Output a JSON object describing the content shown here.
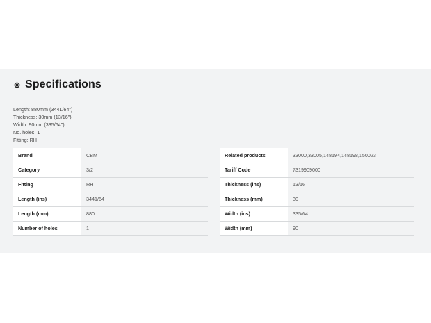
{
  "section": {
    "title": "Specifications",
    "icon": "gear-icon"
  },
  "summary": [
    "Length: 880mm (3441/64\")",
    "Thickness: 30mm (13/16\")",
    "Width: 90mm (335/64\")",
    "No. holes: 1",
    "Fitting: RH"
  ],
  "left_table": [
    {
      "label": "Brand",
      "value": "CBM"
    },
    {
      "label": "Category",
      "value": "3/2"
    },
    {
      "label": "Fitting",
      "value": "RH"
    },
    {
      "label": "Length (ins)",
      "value": "3441/64"
    },
    {
      "label": "Length (mm)",
      "value": "880"
    },
    {
      "label": "Number of holes",
      "value": "1"
    }
  ],
  "right_table": [
    {
      "label": "Related products",
      "value": "33000,33005,148194,148198,150023"
    },
    {
      "label": "Tariff Code",
      "value": "7319909000"
    },
    {
      "label": "Thickness (ins)",
      "value": "13/16"
    },
    {
      "label": "Thickness (mm)",
      "value": "30"
    },
    {
      "label": "Width (ins)",
      "value": "335/64"
    },
    {
      "label": "Width (mm)",
      "value": "90"
    }
  ]
}
